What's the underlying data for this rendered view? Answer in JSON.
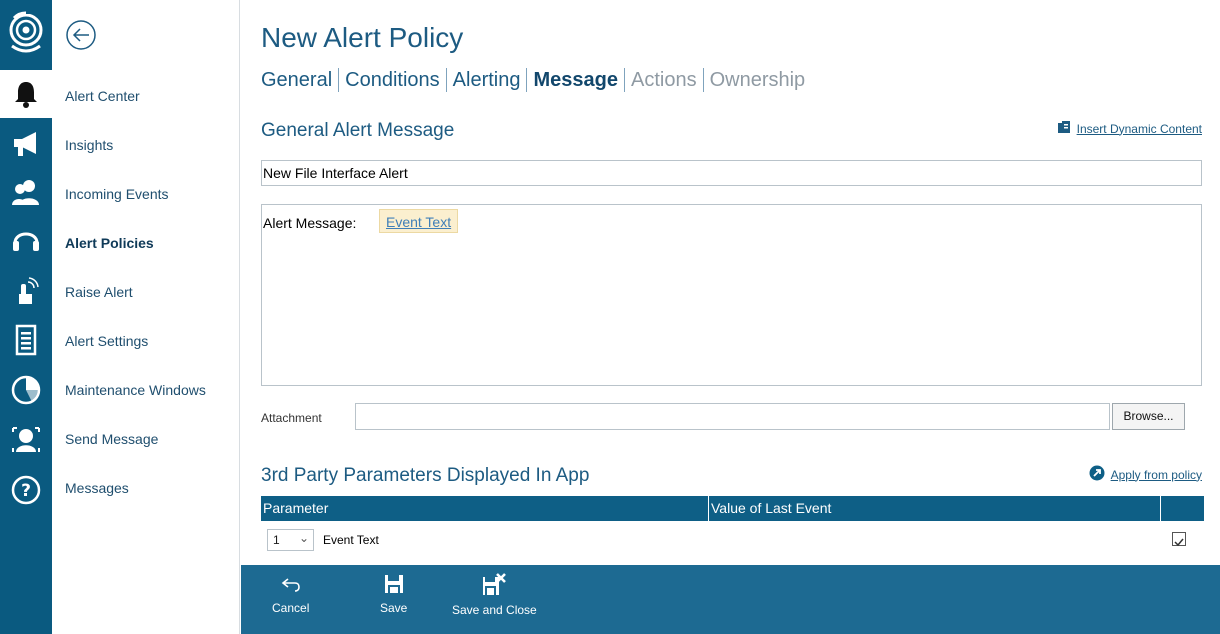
{
  "nav": {
    "items": [
      {
        "label": "Alert Center",
        "active": false
      },
      {
        "label": "Insights",
        "active": false
      },
      {
        "label": "Incoming Events",
        "active": false
      },
      {
        "label": "Alert Policies",
        "active": true
      },
      {
        "label": "Raise Alert",
        "active": false
      },
      {
        "label": "Alert Settings",
        "active": false
      },
      {
        "label": "Maintenance Windows",
        "active": false
      },
      {
        "label": "Send Message",
        "active": false
      },
      {
        "label": "Messages",
        "active": false
      }
    ]
  },
  "rail": {
    "icons": [
      "logo-icon",
      "bell-icon",
      "megaphone-icon",
      "users-icon",
      "headset-icon",
      "touch-icon",
      "document-icon",
      "pie-chart-icon",
      "profile-icon",
      "help-icon"
    ]
  },
  "page": {
    "title": "New Alert Policy",
    "tabs": [
      {
        "label": "General",
        "state": "normal"
      },
      {
        "label": "Conditions",
        "state": "normal"
      },
      {
        "label": "Alerting",
        "state": "normal"
      },
      {
        "label": "Message",
        "state": "current"
      },
      {
        "label": "Actions",
        "state": "dim"
      },
      {
        "label": "Ownership",
        "state": "dim"
      }
    ]
  },
  "message_section": {
    "title": "General Alert Message",
    "insert_link": "Insert Dynamic Content",
    "subject_value": "New File Interface Alert",
    "body_label": "Alert Message:",
    "dynamic_token": "Event Text"
  },
  "attachment": {
    "label": "Attachment",
    "value": "",
    "browse_label": "Browse..."
  },
  "params_section": {
    "title": "3rd Party Parameters Displayed In App",
    "apply_link": "Apply from policy",
    "columns": [
      "Parameter",
      "Value of Last Event",
      ""
    ],
    "rows": [
      {
        "index": "1",
        "parameter": "Event Text",
        "value": "",
        "checked": true
      }
    ]
  },
  "toolbar": {
    "cancel_label": "Cancel",
    "save_label": "Save",
    "save_close_label": "Save and Close"
  },
  "colors": {
    "rail": "#0a5a80",
    "accent": "#1d5b82",
    "toolbar": "#1d6a92",
    "grid_header": "#0e5f86"
  }
}
